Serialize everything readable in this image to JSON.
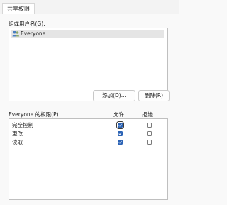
{
  "tabs": [
    {
      "label": "共享权限"
    }
  ],
  "groups": {
    "label": "组或用户名(G):",
    "items": [
      {
        "name": "Everyone",
        "icon": "users-icon"
      }
    ]
  },
  "buttons": {
    "add": "添加(D)...",
    "remove": "删除(R)"
  },
  "permissions": {
    "title": "Everyone 的权限(P)",
    "allow_header": "允许",
    "deny_header": "拒绝",
    "rows": [
      {
        "label": "完全控制",
        "allow": true,
        "deny": false
      },
      {
        "label": "更改",
        "allow": true,
        "deny": false
      },
      {
        "label": "读取",
        "allow": true,
        "deny": false
      }
    ]
  },
  "colors": {
    "accent": "#2a62b5",
    "selection": "#e5e5e5"
  }
}
